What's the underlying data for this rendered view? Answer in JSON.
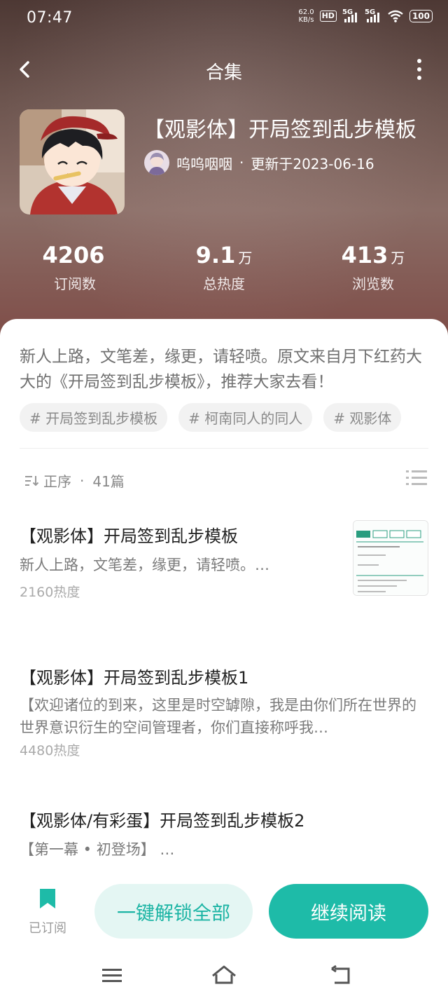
{
  "status": {
    "time": "07:47",
    "net_speed_value": "62.0",
    "net_speed_unit": "KB/s",
    "hd_badge": "HD",
    "signal1": "5G",
    "signal2": "5G",
    "battery": "100"
  },
  "header": {
    "title": "合集"
  },
  "book": {
    "title": "【观影体】开局签到乱步模板",
    "author": "呜呜咽咽",
    "dot": "·",
    "updated": "更新于2023-06-16",
    "cover_icon": "anime-cover-image",
    "avatar_icon": "author-avatar-image"
  },
  "stats": [
    {
      "value": "4206",
      "unit": "",
      "label": "订阅数"
    },
    {
      "value": "9.1",
      "unit": "万",
      "label": "总热度"
    },
    {
      "value": "413",
      "unit": "万",
      "label": "浏览数"
    }
  ],
  "description": "新人上路，文笔差，缘更，请轻喷。原文来自月下红药大大的《开局签到乱步模板》，推荐大家去看！",
  "tags": [
    "# 开局签到乱步模板",
    "# 柯南同人的同人",
    "# 观影体"
  ],
  "list_header": {
    "sort_label": "正序",
    "dot": "·",
    "count": "41篇"
  },
  "chapters": [
    {
      "title": "【观影体】开局签到乱步模板",
      "excerpt": "新人上路，文笔差，缘更，请轻喷。…",
      "heat": "2160热度"
    },
    {
      "title": "【观影体】开局签到乱步模板1",
      "excerpt": "【欢迎诸位的到来，这里是时空罅隙，我是由你们所在世界的世界意识衍生的空间管理者，你们直接称呼我…",
      "heat": "4480热度"
    },
    {
      "title": "【观影体/有彩蛋】开局签到乱步模板2",
      "excerpt": "【第一幕 • 初登场】 …",
      "heat": ""
    }
  ],
  "bottom": {
    "subscribed_label": "已订阅",
    "unlock_label": "一键解锁全部",
    "continue_label": "继续阅读"
  },
  "colors": {
    "accent": "#1ebba8",
    "accent_light": "#e4f6f3"
  }
}
